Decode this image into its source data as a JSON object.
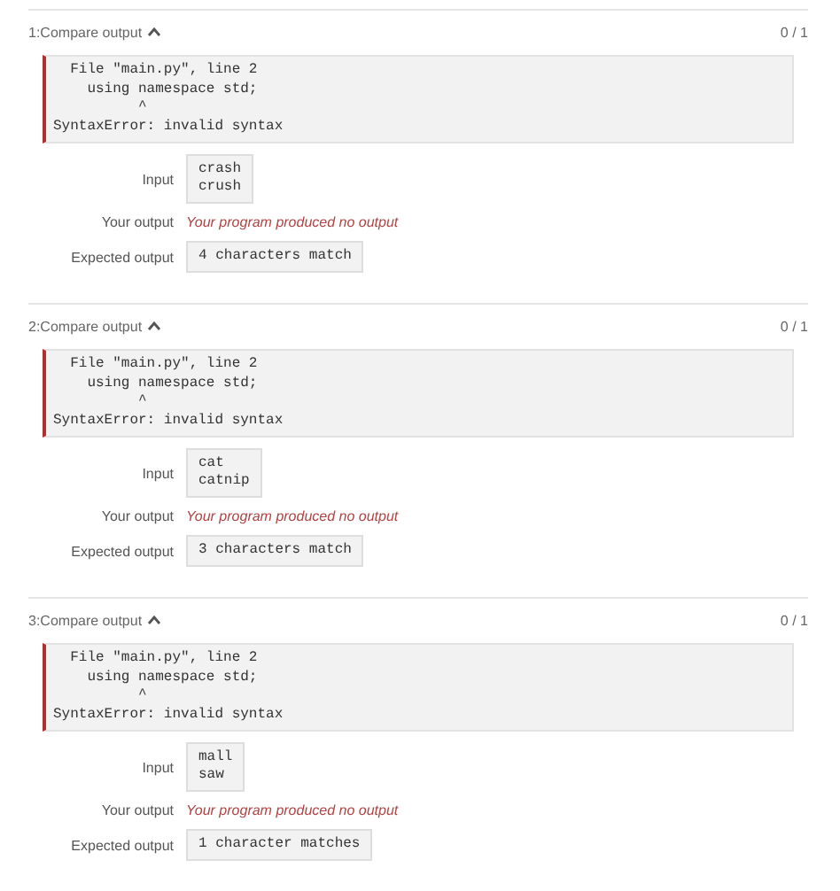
{
  "tests": [
    {
      "title": "1:Compare output",
      "expanded": true,
      "score": "0 / 1",
      "error_lines": [
        "  File \"main.py\", line 2",
        "    using namespace std;",
        "          ^",
        "SyntaxError: invalid syntax"
      ],
      "input_label": "Input",
      "input_lines": [
        "crash",
        "crush"
      ],
      "your_output_label": "Your output",
      "your_output": "Your program produced no output",
      "expected_label": "Expected output",
      "expected_output": "4 characters match"
    },
    {
      "title": "2:Compare output",
      "expanded": true,
      "score": "0 / 1",
      "error_lines": [
        "  File \"main.py\", line 2",
        "    using namespace std;",
        "          ^",
        "SyntaxError: invalid syntax"
      ],
      "input_label": "Input",
      "input_lines": [
        "cat",
        "catnip"
      ],
      "your_output_label": "Your output",
      "your_output": "Your program produced no output",
      "expected_label": "Expected output",
      "expected_output": "3 characters match"
    },
    {
      "title": "3:Compare output",
      "expanded": true,
      "score": "0 / 1",
      "error_lines": [
        "  File \"main.py\", line 2",
        "    using namespace std;",
        "          ^",
        "SyntaxError: invalid syntax"
      ],
      "input_label": "Input",
      "input_lines": [
        "mall",
        "saw"
      ],
      "your_output_label": "Your output",
      "your_output": "Your program produced no output",
      "expected_label": "Expected output",
      "expected_output": "1 character matches"
    }
  ]
}
